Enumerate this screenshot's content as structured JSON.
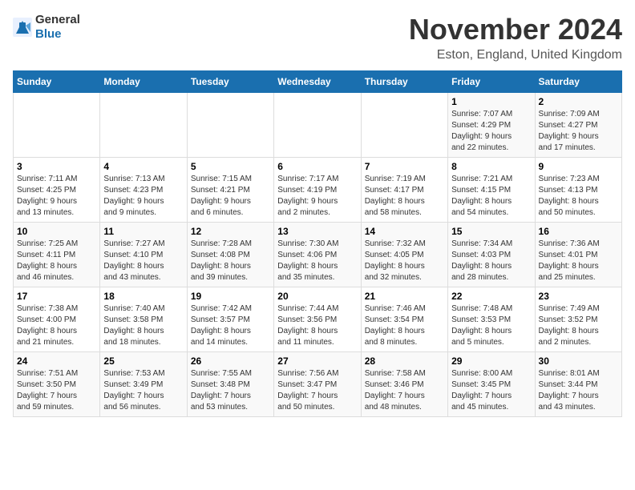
{
  "header": {
    "logo_general": "General",
    "logo_blue": "Blue",
    "title": "November 2024",
    "subtitle": "Eston, England, United Kingdom"
  },
  "weekdays": [
    "Sunday",
    "Monday",
    "Tuesday",
    "Wednesday",
    "Thursday",
    "Friday",
    "Saturday"
  ],
  "weeks": [
    [
      {
        "day": "",
        "detail": ""
      },
      {
        "day": "",
        "detail": ""
      },
      {
        "day": "",
        "detail": ""
      },
      {
        "day": "",
        "detail": ""
      },
      {
        "day": "",
        "detail": ""
      },
      {
        "day": "1",
        "detail": "Sunrise: 7:07 AM\nSunset: 4:29 PM\nDaylight: 9 hours\nand 22 minutes."
      },
      {
        "day": "2",
        "detail": "Sunrise: 7:09 AM\nSunset: 4:27 PM\nDaylight: 9 hours\nand 17 minutes."
      }
    ],
    [
      {
        "day": "3",
        "detail": "Sunrise: 7:11 AM\nSunset: 4:25 PM\nDaylight: 9 hours\nand 13 minutes."
      },
      {
        "day": "4",
        "detail": "Sunrise: 7:13 AM\nSunset: 4:23 PM\nDaylight: 9 hours\nand 9 minutes."
      },
      {
        "day": "5",
        "detail": "Sunrise: 7:15 AM\nSunset: 4:21 PM\nDaylight: 9 hours\nand 6 minutes."
      },
      {
        "day": "6",
        "detail": "Sunrise: 7:17 AM\nSunset: 4:19 PM\nDaylight: 9 hours\nand 2 minutes."
      },
      {
        "day": "7",
        "detail": "Sunrise: 7:19 AM\nSunset: 4:17 PM\nDaylight: 8 hours\nand 58 minutes."
      },
      {
        "day": "8",
        "detail": "Sunrise: 7:21 AM\nSunset: 4:15 PM\nDaylight: 8 hours\nand 54 minutes."
      },
      {
        "day": "9",
        "detail": "Sunrise: 7:23 AM\nSunset: 4:13 PM\nDaylight: 8 hours\nand 50 minutes."
      }
    ],
    [
      {
        "day": "10",
        "detail": "Sunrise: 7:25 AM\nSunset: 4:11 PM\nDaylight: 8 hours\nand 46 minutes."
      },
      {
        "day": "11",
        "detail": "Sunrise: 7:27 AM\nSunset: 4:10 PM\nDaylight: 8 hours\nand 43 minutes."
      },
      {
        "day": "12",
        "detail": "Sunrise: 7:28 AM\nSunset: 4:08 PM\nDaylight: 8 hours\nand 39 minutes."
      },
      {
        "day": "13",
        "detail": "Sunrise: 7:30 AM\nSunset: 4:06 PM\nDaylight: 8 hours\nand 35 minutes."
      },
      {
        "day": "14",
        "detail": "Sunrise: 7:32 AM\nSunset: 4:05 PM\nDaylight: 8 hours\nand 32 minutes."
      },
      {
        "day": "15",
        "detail": "Sunrise: 7:34 AM\nSunset: 4:03 PM\nDaylight: 8 hours\nand 28 minutes."
      },
      {
        "day": "16",
        "detail": "Sunrise: 7:36 AM\nSunset: 4:01 PM\nDaylight: 8 hours\nand 25 minutes."
      }
    ],
    [
      {
        "day": "17",
        "detail": "Sunrise: 7:38 AM\nSunset: 4:00 PM\nDaylight: 8 hours\nand 21 minutes."
      },
      {
        "day": "18",
        "detail": "Sunrise: 7:40 AM\nSunset: 3:58 PM\nDaylight: 8 hours\nand 18 minutes."
      },
      {
        "day": "19",
        "detail": "Sunrise: 7:42 AM\nSunset: 3:57 PM\nDaylight: 8 hours\nand 14 minutes."
      },
      {
        "day": "20",
        "detail": "Sunrise: 7:44 AM\nSunset: 3:56 PM\nDaylight: 8 hours\nand 11 minutes."
      },
      {
        "day": "21",
        "detail": "Sunrise: 7:46 AM\nSunset: 3:54 PM\nDaylight: 8 hours\nand 8 minutes."
      },
      {
        "day": "22",
        "detail": "Sunrise: 7:48 AM\nSunset: 3:53 PM\nDaylight: 8 hours\nand 5 minutes."
      },
      {
        "day": "23",
        "detail": "Sunrise: 7:49 AM\nSunset: 3:52 PM\nDaylight: 8 hours\nand 2 minutes."
      }
    ],
    [
      {
        "day": "24",
        "detail": "Sunrise: 7:51 AM\nSunset: 3:50 PM\nDaylight: 7 hours\nand 59 minutes."
      },
      {
        "day": "25",
        "detail": "Sunrise: 7:53 AM\nSunset: 3:49 PM\nDaylight: 7 hours\nand 56 minutes."
      },
      {
        "day": "26",
        "detail": "Sunrise: 7:55 AM\nSunset: 3:48 PM\nDaylight: 7 hours\nand 53 minutes."
      },
      {
        "day": "27",
        "detail": "Sunrise: 7:56 AM\nSunset: 3:47 PM\nDaylight: 7 hours\nand 50 minutes."
      },
      {
        "day": "28",
        "detail": "Sunrise: 7:58 AM\nSunset: 3:46 PM\nDaylight: 7 hours\nand 48 minutes."
      },
      {
        "day": "29",
        "detail": "Sunrise: 8:00 AM\nSunset: 3:45 PM\nDaylight: 7 hours\nand 45 minutes."
      },
      {
        "day": "30",
        "detail": "Sunrise: 8:01 AM\nSunset: 3:44 PM\nDaylight: 7 hours\nand 43 minutes."
      }
    ]
  ]
}
